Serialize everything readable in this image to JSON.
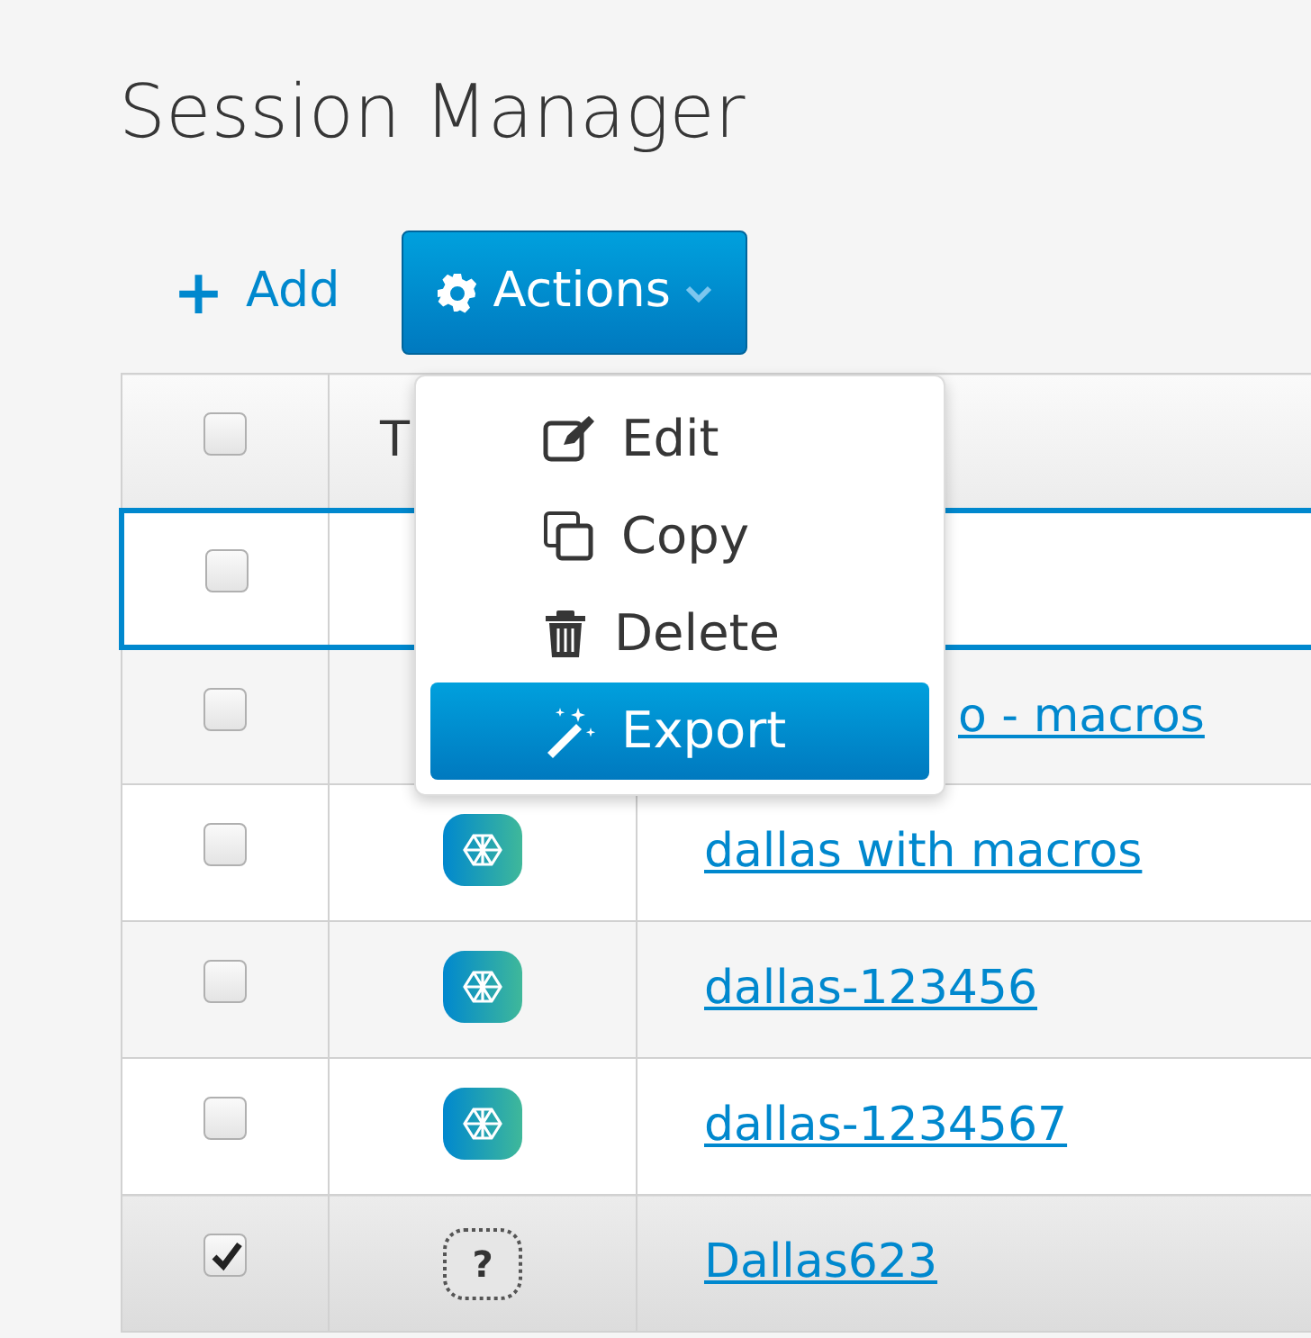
{
  "title": "Session Manager",
  "toolbar": {
    "add": {
      "icon": "+",
      "label": "Add"
    },
    "actions": {
      "label": "Actions",
      "expanded": true
    }
  },
  "actions_menu": [
    {
      "kind": "edit",
      "label": "Edit",
      "selected": false
    },
    {
      "kind": "copy",
      "label": "Copy",
      "selected": false
    },
    {
      "kind": "delete",
      "label": "Delete",
      "selected": false
    },
    {
      "kind": "export",
      "label": "Export",
      "selected": true
    }
  ],
  "table": {
    "header": {
      "checked": false,
      "columns": [
        "T"
      ]
    },
    "rows": [
      {
        "checked": false,
        "focused": true
      },
      {
        "checked": false,
        "focused": false,
        "name": "o - macros"
      },
      {
        "checked": false,
        "focused": false,
        "icon": {
          "kind": "app"
        },
        "name": "dallas with macros"
      },
      {
        "checked": false,
        "focused": false,
        "icon": {
          "kind": "app"
        },
        "name": "dallas-123456"
      },
      {
        "checked": false,
        "focused": false,
        "icon": {
          "kind": "app"
        },
        "name": "dallas-1234567"
      },
      {
        "checked": true,
        "focused": false,
        "icon": {
          "kind": "unknown",
          "glyph": "?"
        },
        "name": "Dallas623"
      }
    ]
  }
}
